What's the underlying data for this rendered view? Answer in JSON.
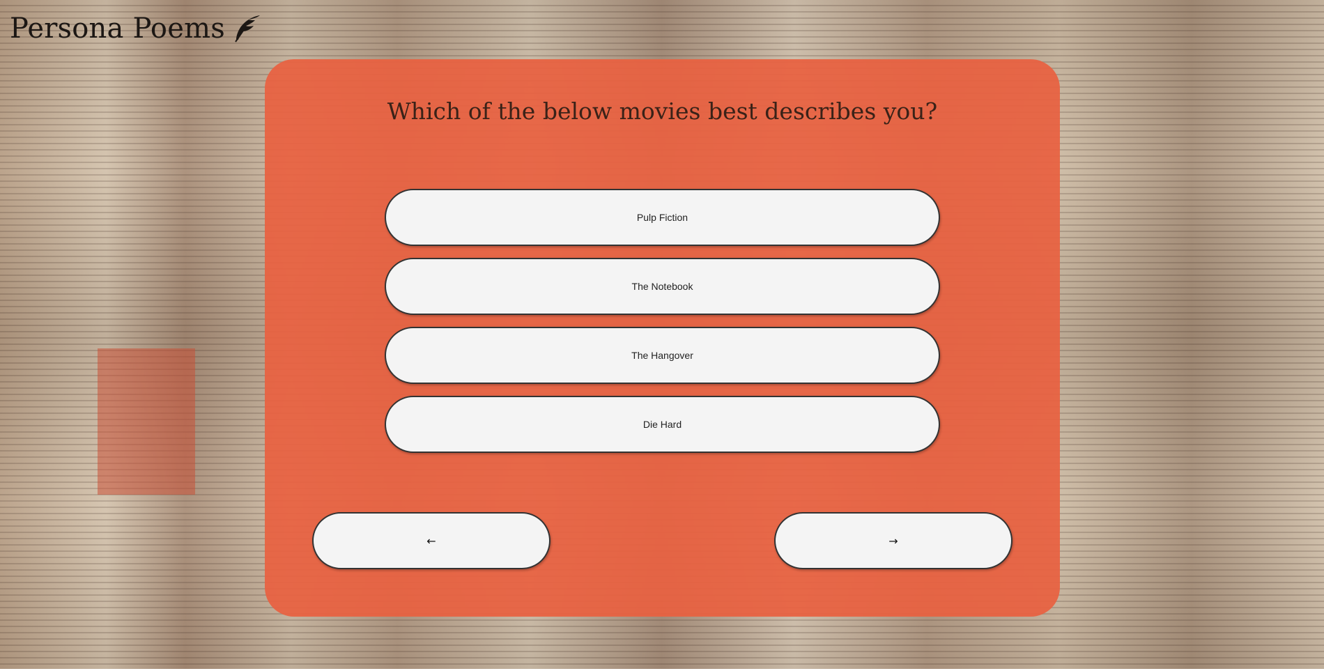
{
  "site": {
    "logo_text": "Persona Poems",
    "logo_icon": "feather-quill-icon"
  },
  "quiz": {
    "question": "Which of the below movies best describes you?",
    "options": [
      {
        "label": "Pulp Fiction"
      },
      {
        "label": "The Notebook"
      },
      {
        "label": "The Hangover"
      },
      {
        "label": "Die Hard"
      }
    ],
    "nav": {
      "prev_label": "←",
      "next_label": "→"
    }
  },
  "colors": {
    "card_accent": "#e86141",
    "button_bg": "#f4f4f4",
    "button_border": "#333333"
  }
}
